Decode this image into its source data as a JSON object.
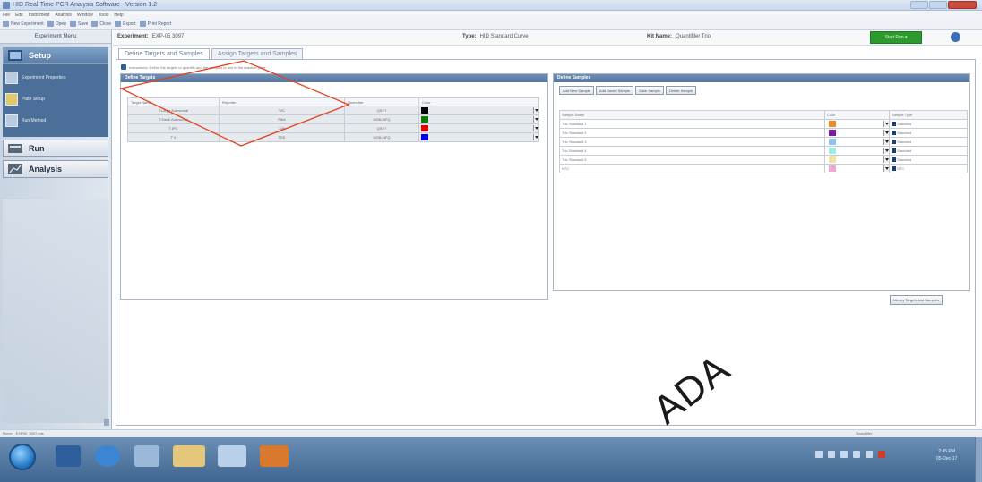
{
  "window": {
    "title": "HID Real-Time PCR Analysis Software - Version 1.2"
  },
  "menu": [
    "File",
    "Edit",
    "Instrument",
    "Analysis",
    "Window",
    "Tools",
    "Help"
  ],
  "toolbar": [
    {
      "label": "New Experiment",
      "icon": "new-icon"
    },
    {
      "label": "Open",
      "icon": "open-icon"
    },
    {
      "label": "Save",
      "icon": "save-icon"
    },
    {
      "label": "Close",
      "icon": "close-doc-icon"
    },
    {
      "label": "Export",
      "icon": "export-icon"
    },
    {
      "label": "Print Report",
      "icon": "print-icon"
    }
  ],
  "sidebar": {
    "header": "Experiment Menu",
    "setup": "Setup",
    "sub_items": [
      "Experiment Properties",
      "Plate Setup",
      "Run Method"
    ],
    "run": "Run",
    "analysis": "Analysis"
  },
  "experiment": {
    "name_label": "Experiment:",
    "name_value": "EXP-05 3097",
    "type_label": "Type:",
    "type_value": "HID Standard Curve",
    "kit_label": "Kit Name:",
    "kit_value": "Quantifiler Trio",
    "start_run": "Start Run"
  },
  "tabs": [
    "Define Targets and Samples",
    "Assign Targets and Samples"
  ],
  "hint": "Instructions: Define the targets to quantify and the samples to test in the reaction plate.",
  "targets": {
    "title": "Define Targets",
    "columns": [
      "Target Name",
      "Reporter",
      "Quencher",
      "Color"
    ],
    "rows": [
      {
        "name": "T.Large Autosomal",
        "reporter": "VIC",
        "quencher": "QSY7",
        "color": "#000000"
      },
      {
        "name": "T.Small Autosomal",
        "reporter": "FAM",
        "quencher": "MGB-NFQ",
        "color": "#0a7a0a"
      },
      {
        "name": "T.IPC",
        "reporter": "JUN",
        "quencher": "QSY7",
        "color": "#e00000"
      },
      {
        "name": "T.Y",
        "reporter": "TED",
        "quencher": "MGB-NFQ",
        "color": "#0000e0"
      }
    ]
  },
  "samples": {
    "title": "Define Samples",
    "buttons": [
      "Add New Sample",
      "Add Saved Sample",
      "Save Sample",
      "Delete Sample"
    ],
    "columns": [
      "Sample Name",
      "Color",
      "Sample Type"
    ],
    "rows": [
      {
        "name": "Trio Standard 1",
        "color": "#f08a24",
        "type": "Standard"
      },
      {
        "name": "Trio Standard 2",
        "color": "#7a1aa8",
        "type": "Standard"
      },
      {
        "name": "Trio Standard 3",
        "color": "#8ec4ea",
        "type": "Standard"
      },
      {
        "name": "Trio Standard 4",
        "color": "#9feee6",
        "type": "Standard"
      },
      {
        "name": "Trio Standard 5",
        "color": "#efe3a4",
        "type": "Standard"
      },
      {
        "name": "NTC",
        "color": "#f2a6d6",
        "type": "NTC"
      }
    ],
    "save_button": "Library Targets and Samples"
  },
  "statusbar": {
    "home": "Home",
    "doc_tab": "EXP05_3097.eds",
    "right": "Quantifiler"
  },
  "watermark": "ADA",
  "clock": {
    "time": "2:45 PM",
    "date": "05-Dec-17"
  },
  "colors": {
    "accent": "#56779f",
    "start_run": "#2c9a2c",
    "annotation": "#e5401a"
  }
}
